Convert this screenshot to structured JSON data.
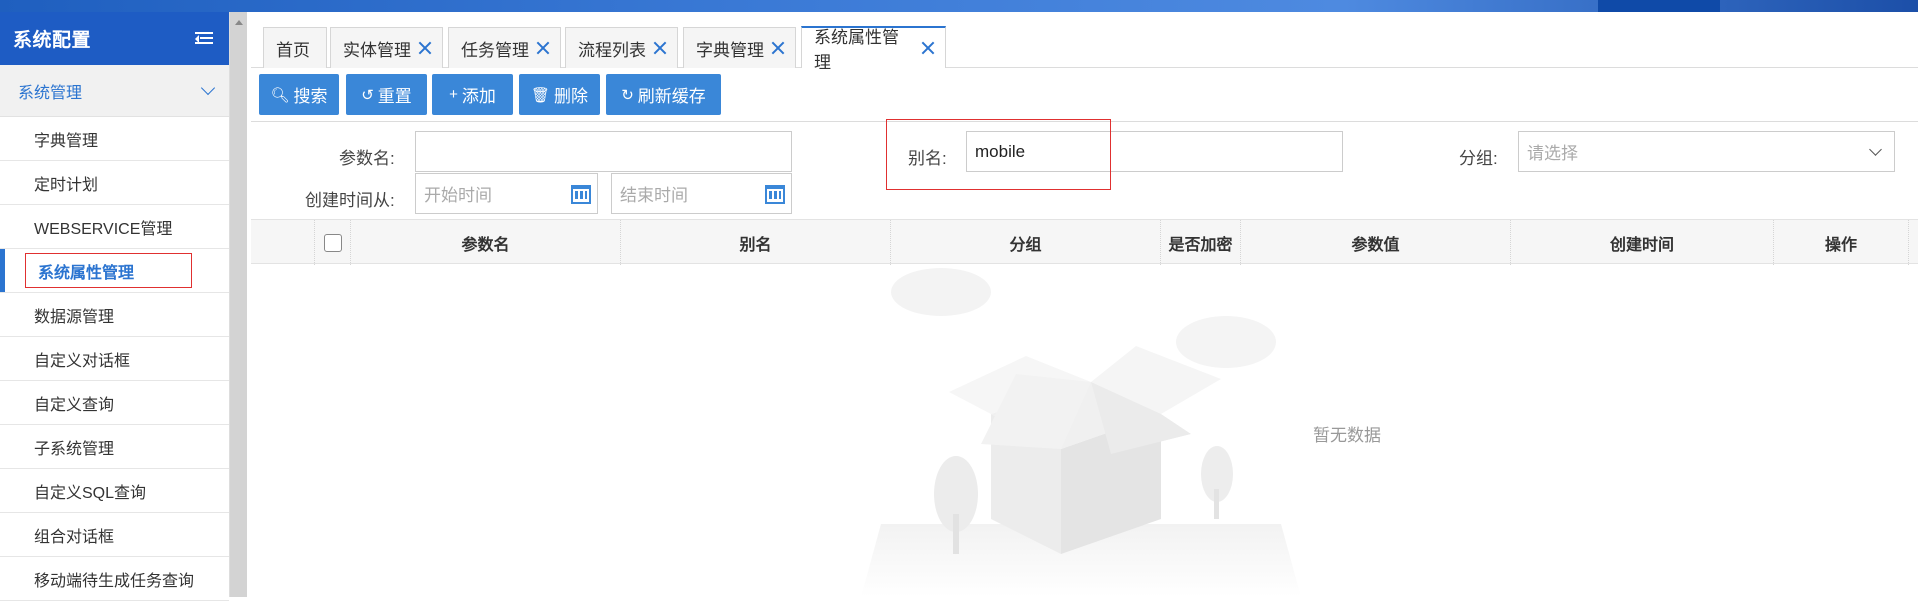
{
  "sidebar": {
    "title": "系统配置",
    "group": "系统管理",
    "items": [
      {
        "label": "字典管理"
      },
      {
        "label": "定时计划"
      },
      {
        "label": "WEBSERVICE管理"
      },
      {
        "label": "系统属性管理"
      },
      {
        "label": "数据源管理"
      },
      {
        "label": "自定义对话框"
      },
      {
        "label": "自定义查询"
      },
      {
        "label": "子系统管理"
      },
      {
        "label": "自定义SQL查询"
      },
      {
        "label": "组合对话框"
      },
      {
        "label": "移动端待生成任务查询"
      }
    ]
  },
  "tabs": [
    {
      "label": "首页"
    },
    {
      "label": "实体管理"
    },
    {
      "label": "任务管理"
    },
    {
      "label": "流程列表"
    },
    {
      "label": "字典管理"
    },
    {
      "label": "系统属性管理"
    }
  ],
  "toolbar": {
    "search": "搜索",
    "reset": "重置",
    "add": "添加",
    "delete": "删除",
    "refresh_cache": "刷新缓存"
  },
  "form": {
    "param_name_label": "参数名:",
    "param_name_value": "",
    "alias_label": "别名:",
    "alias_value": "mobile",
    "group_label": "分组:",
    "group_placeholder": "请选择",
    "created_from_label": "创建时间从:",
    "start_time_placeholder": "开始时间",
    "end_time_placeholder": "结束时间"
  },
  "table": {
    "columns": [
      "参数名",
      "别名",
      "分组",
      "是否加密",
      "参数值",
      "创建时间",
      "操作"
    ],
    "empty_text": "暂无数据"
  },
  "colors": {
    "primary": "#3a87d8",
    "header": "#1e5cc4",
    "highlight": "#e03030"
  }
}
